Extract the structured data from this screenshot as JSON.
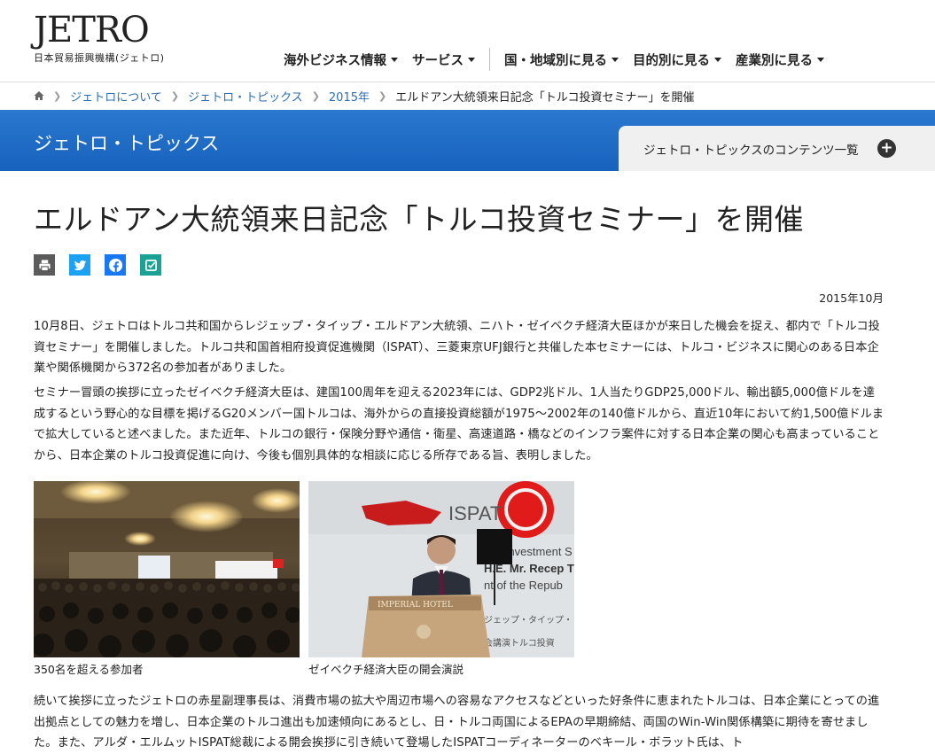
{
  "logo": {
    "mark": "JETRO",
    "sub": "日本貿易振興機構(ジェトロ)"
  },
  "gnav": {
    "items": [
      "海外ビジネス情報",
      "サービス",
      "国・地域別に見る",
      "目的別に見る",
      "産業別に見る"
    ]
  },
  "breadcrumb": [
    "ジェトロについて",
    "ジェトロ・トピックス",
    "2015年",
    "エルドアン大統領来日記念「トルコ投資セミナー」を開催"
  ],
  "band": {
    "title": "ジェトロ・トピックス",
    "tab_label": "ジェトロ・トピックスのコンテンツ一覧"
  },
  "article": {
    "title": "エルドアン大統領来日記念「トルコ投資セミナー」を開催",
    "date": "2015年10月",
    "p1": "10月8日、ジェトロはトルコ共和国からレジェップ・タイップ・エルドアン大統領、ニハト・ゼイベクチ経済大臣ほかが来日した機会を捉え、都内で「トルコ投資セミナー」を開催しました。トルコ共和国首相府投資促進機関（ISPAT）、三菱東京UFJ銀行と共催した本セミナーには、トルコ・ビジネスに関心のある日本企業や関係機関から372名の参加者がありました。",
    "p2": "セミナー冒頭の挨拶に立ったゼイベクチ経済大臣は、建国100周年を迎える2023年には、GDP2兆ドル、1人当たりGDP25,000ドル、輸出額5,000億ドルを達成するという野心的な目標を掲げるG20メンバー国トルコは、海外からの直接投資総額が1975〜2002年の140億ドルから、直近10年において約1,500億ドルまで拡大していると述べました。また近年、トルコの銀行・保険分野や通信・衛星、高速道路・橋などのインフラ案件に対する日本企業の関心も高まっていることから、日本企業のトルコ投資促進に向け、今後も個別具体的な相談に応じる所存である旨、表明しました。",
    "photo1_caption": "350名を超える参加者",
    "photo2_caption": "ゼイベクチ経済大臣の開会演説",
    "photo2_text": {
      "ispat": "ISPAT",
      "podium": "IMPERIAL HOTEL",
      "banner1": "key Investment S",
      "banner2": "H.E. Mr. Recep T",
      "banner3": "nt of the Repub",
      "banner4": "ジェップ・タイップ・",
      "banner5": "会講演トルコ投資"
    },
    "p3": "続いて挨拶に立ったジェトロの赤星副理事長は、消費市場の拡大や周辺市場への容易なアクセスなどといった好条件に恵まれたトルコは、日本企業にとっての進出拠点としての魅力を増し、日本企業のトルコ進出も加速傾向にあるとし、日・トルコ両国によるEPAの早期締結、両国のWin-Win関係構築に期待を寄せました。また、アルダ・エルムットISPAT総裁による開会挨拶に引き続いて登場したISPATコーディネーターのベキール・ボラット氏は、ト"
  },
  "colors": {
    "band": "#1a68c4",
    "link": "#2a6fb5",
    "print": "#5b5b5b",
    "twitter": "#1da1f2",
    "facebook": "#1877f2",
    "check": "#1aa394"
  }
}
